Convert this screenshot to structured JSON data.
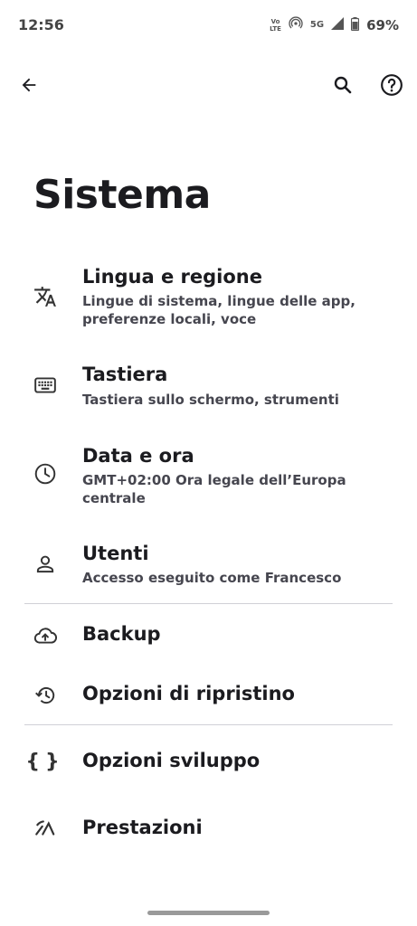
{
  "status_bar": {
    "time": "12:56",
    "volte_top": "Vo",
    "volte_bottom": "LTE",
    "network": "5G",
    "battery": "69%"
  },
  "toolbar": {
    "back_icon": "arrow-back-icon",
    "search_icon": "search-icon",
    "help_icon": "help-icon"
  },
  "page_title": "Sistema",
  "items": [
    {
      "icon": "translate-icon",
      "title": "Lingua e regione",
      "subtitle": "Lingue di sistema, lingue delle app, preferenze locali, voce"
    },
    {
      "icon": "keyboard-icon",
      "title": "Tastiera",
      "subtitle": "Tastiera sullo schermo, strumenti"
    },
    {
      "icon": "clock-icon",
      "title": "Data e ora",
      "subtitle": "GMT+02:00 Ora legale dell’Europa centrale"
    },
    {
      "icon": "person-icon",
      "title": "Utenti",
      "subtitle": "Accesso eseguito come Francesco"
    },
    {
      "icon": "cloud-upload-icon",
      "title": "Backup"
    },
    {
      "icon": "restore-icon",
      "title": "Opzioni di ripristino"
    },
    {
      "icon": "code-braces-icon",
      "title": "Opzioni sviluppo"
    },
    {
      "icon": "performance-icon",
      "title": "Prestazioni"
    }
  ],
  "colors": {
    "text": "#1b1b1f",
    "subtext": "#46464f",
    "divider": "#d0d0d6",
    "background": "#ffffff"
  }
}
